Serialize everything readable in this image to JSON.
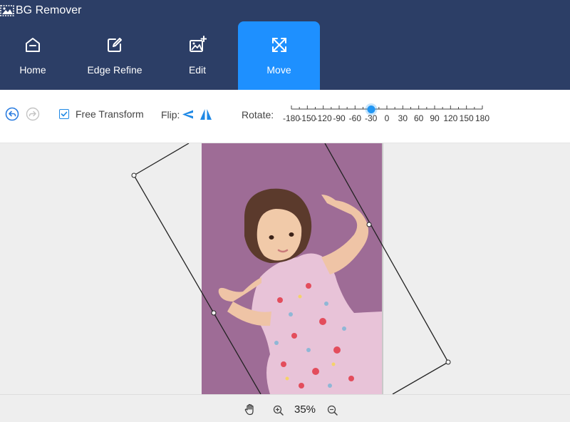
{
  "app": {
    "title": "BG Remover"
  },
  "nav": {
    "tabs": [
      {
        "label": "Home",
        "icon": "home-icon",
        "active": false
      },
      {
        "label": "Edge Refine",
        "icon": "edge-refine-icon",
        "active": false
      },
      {
        "label": "Edit",
        "icon": "edit-image-icon",
        "active": false
      },
      {
        "label": "Move",
        "icon": "move-arrows-icon",
        "active": true
      }
    ]
  },
  "toolbar": {
    "free_transform_label": "Free Transform",
    "free_transform_checked": true,
    "flip_label": "Flip:",
    "rotate_label": "Rotate:",
    "rotate_scale": [
      "-180",
      "-150",
      "-120",
      "-90",
      "-60",
      "-30",
      "0",
      "30",
      "60",
      "90",
      "120",
      "150",
      "180"
    ],
    "rotate_value": -30
  },
  "zoom": {
    "level": "35%"
  },
  "colors": {
    "header_bg": "#2c3e66",
    "active_tab": "#1e90ff",
    "accent": "#2196f3",
    "image_bg": "#9e6c96"
  }
}
